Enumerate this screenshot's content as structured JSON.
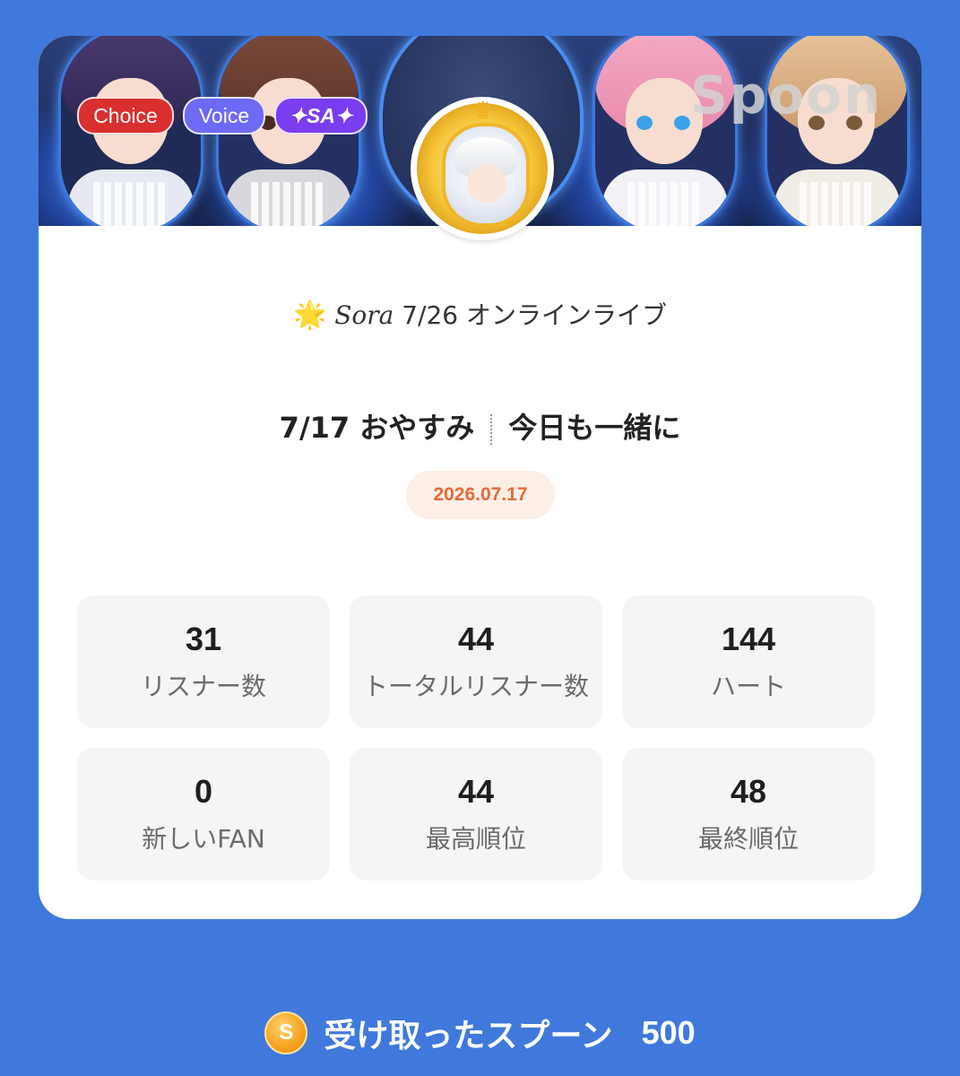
{
  "banner": {
    "brand": "Spoon",
    "badges": {
      "choice": "Choice",
      "voice": "Voice",
      "sa": "✦SA✦"
    }
  },
  "profile": {
    "subtitle_star": "🌟",
    "subtitle_name": "Sora",
    "subtitle_text": " 7/26 オンラインライブ"
  },
  "live": {
    "title_left": "7/17 おやすみ",
    "title_right": "今日も一緒に",
    "date": "2026.07.17"
  },
  "stats": [
    {
      "value": "31",
      "label": "リスナー数"
    },
    {
      "value": "44",
      "label": "トータルリスナー数"
    },
    {
      "value": "144",
      "label": "ハート"
    },
    {
      "value": "0",
      "label": "新しいFAN"
    },
    {
      "value": "44",
      "label": "最高順位"
    },
    {
      "value": "48",
      "label": "最終順位"
    }
  ],
  "footer": {
    "coin_letter": "S",
    "label": "受け取ったスプーン",
    "amount": "500"
  },
  "colors": {
    "background": "#4079db",
    "date_text": "#e56a38",
    "date_pill": "#fdeee6"
  }
}
